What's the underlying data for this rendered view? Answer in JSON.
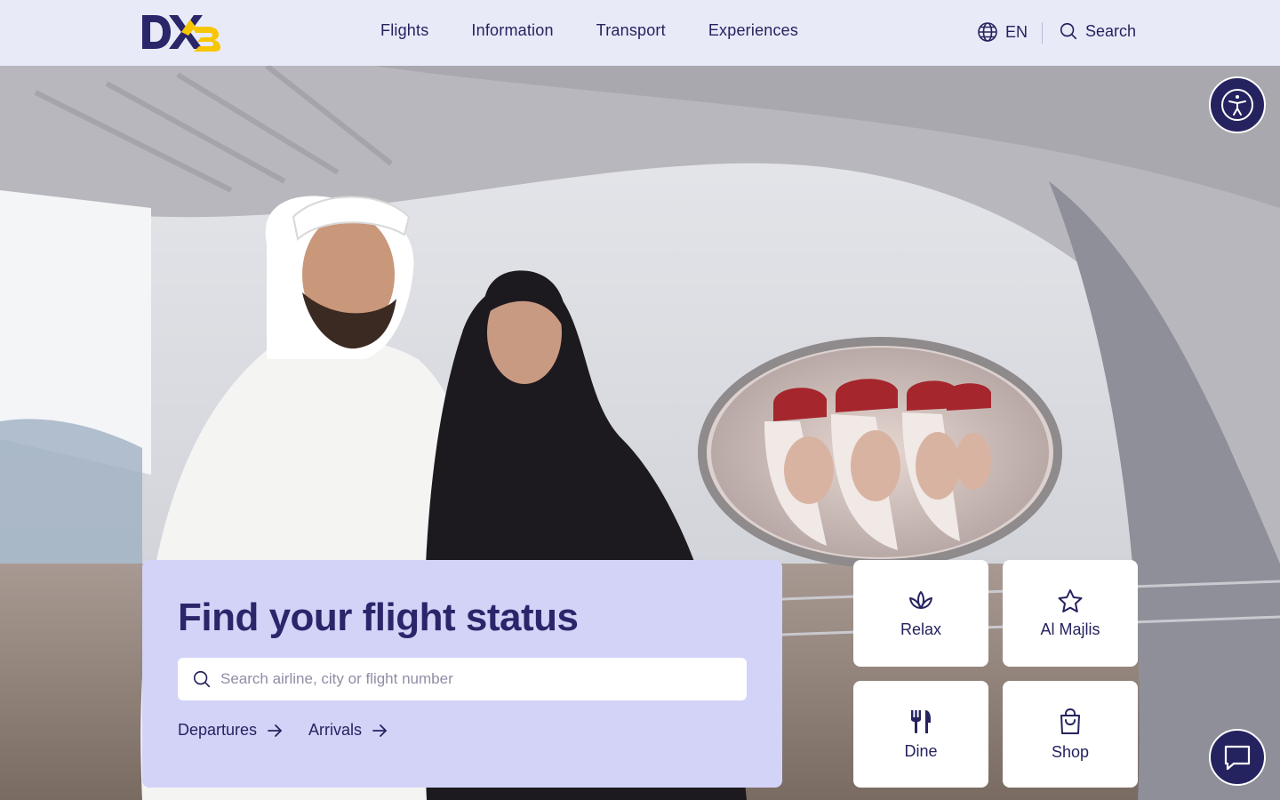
{
  "header": {
    "logo_text": "DXB",
    "nav": [
      {
        "label": "Flights"
      },
      {
        "label": "Information"
      },
      {
        "label": "Transport"
      },
      {
        "label": "Experiences"
      }
    ],
    "language": "EN",
    "search_label": "Search"
  },
  "flight_status": {
    "title": "Find your flight status",
    "search_placeholder": "Search airline, city or flight number",
    "departures_label": "Departures",
    "arrivals_label": "Arrivals"
  },
  "tiles": [
    {
      "label": "Relax",
      "icon": "lotus-icon"
    },
    {
      "label": "Al Majlis",
      "icon": "star-icon"
    },
    {
      "label": "Dine",
      "icon": "fork-knife-icon"
    },
    {
      "label": "Shop",
      "icon": "shopping-bag-icon"
    }
  ],
  "colors": {
    "brand_navy": "#25235f",
    "brand_yellow": "#f7c600",
    "header_bg": "#e9eaf8",
    "card_bg": "#d3d3f8"
  }
}
